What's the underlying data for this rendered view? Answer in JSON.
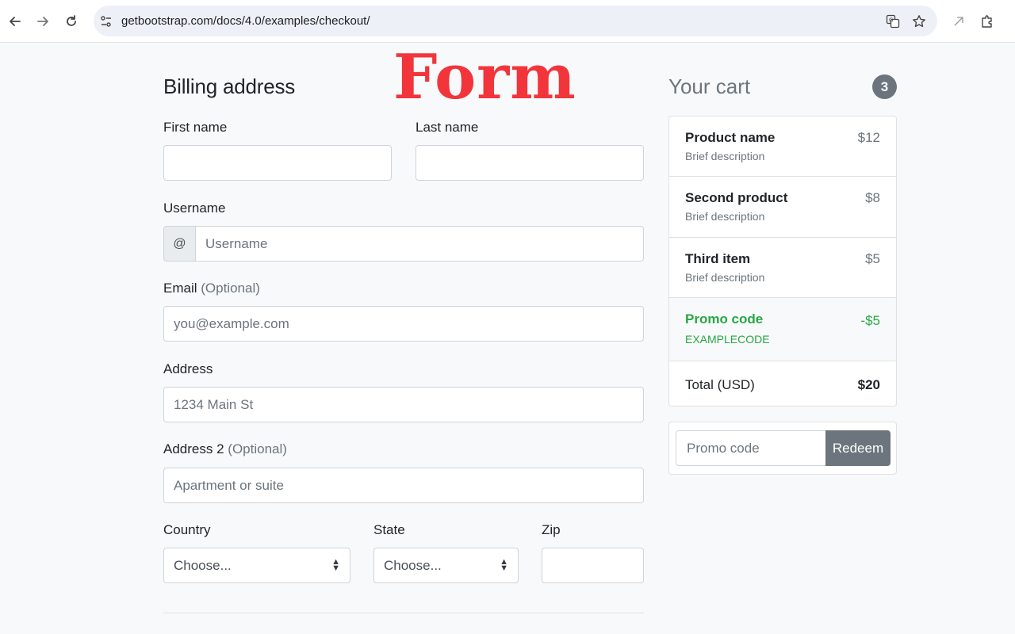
{
  "browser": {
    "url": "getbootstrap.com/docs/4.0/examples/checkout/",
    "back_icon": "back-arrow-icon",
    "forward_icon": "forward-arrow-icon",
    "reload_icon": "reload-icon"
  },
  "overlay": {
    "text": "Form",
    "color": "#f2353b"
  },
  "billing": {
    "title": "Billing address",
    "first_name_label": "First name",
    "last_name_label": "Last name",
    "username_label": "Username",
    "username_prepend": "@",
    "username_placeholder": "Username",
    "email_label": "Email",
    "email_optional": "(Optional)",
    "email_placeholder": "you@example.com",
    "address_label": "Address",
    "address_placeholder": "1234 Main St",
    "address2_label": "Address 2",
    "address2_optional": "(Optional)",
    "address2_placeholder": "Apartment or suite",
    "country_label": "Country",
    "country_value": "Choose...",
    "state_label": "State",
    "state_value": "Choose...",
    "zip_label": "Zip"
  },
  "cart": {
    "title": "Your cart",
    "count": "3",
    "items": [
      {
        "name": "Product name",
        "desc": "Brief description",
        "price": "$12"
      },
      {
        "name": "Second product",
        "desc": "Brief description",
        "price": "$8"
      },
      {
        "name": "Third item",
        "desc": "Brief description",
        "price": "$5"
      }
    ],
    "promo": {
      "name": "Promo code",
      "code": "EXAMPLECODE",
      "amount": "-$5"
    },
    "total_label": "Total (USD)",
    "total_value": "$20",
    "promo_placeholder": "Promo code",
    "redeem_label": "Redeem"
  },
  "colors": {
    "accent": "#6c757d",
    "success": "#28a745",
    "border": "#dee2e6"
  }
}
